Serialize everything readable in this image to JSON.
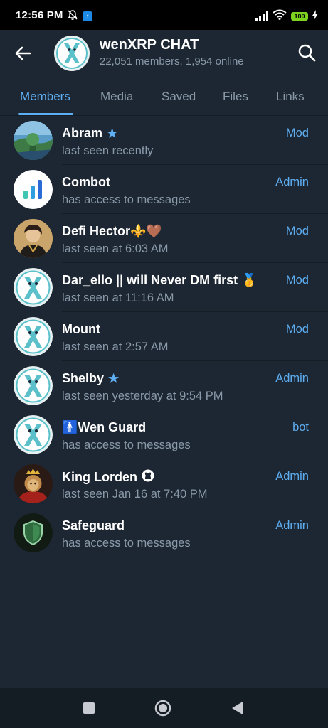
{
  "status_bar": {
    "time": "12:56 PM",
    "battery": "100",
    "icons": [
      "mute-notification-icon",
      "app-update-icon",
      "signal-icon",
      "wifi-icon",
      "battery-icon",
      "charging-icon"
    ]
  },
  "header": {
    "title": "wenXRP CHAT",
    "subtitle": "22,051 members, 1,954 online",
    "back_icon": "back-arrow-icon",
    "search_icon": "search-icon"
  },
  "tabs": [
    {
      "label": "Members",
      "active": true
    },
    {
      "label": "Media",
      "active": false
    },
    {
      "label": "Saved",
      "active": false
    },
    {
      "label": "Files",
      "active": false
    },
    {
      "label": "Links",
      "active": false
    }
  ],
  "members": [
    {
      "name": "Abram",
      "badge": "★",
      "status": "last seen recently",
      "role": "Mod",
      "avatar": "landscape"
    },
    {
      "name": "Combot",
      "badge": "",
      "status": "has access to messages",
      "role": "Admin",
      "avatar": "combot"
    },
    {
      "name": "Defi Hector⚜️🤎",
      "badge": "",
      "status": "last seen at 6:03 AM",
      "role": "Mod",
      "avatar": "person"
    },
    {
      "name": "Dar_ello || will Never DM first 🥇",
      "badge": "",
      "status": "last seen at 11:16 AM",
      "role": "Mod",
      "avatar": "x-logo"
    },
    {
      "name": "Mount",
      "badge": "",
      "status": "last seen at 2:57 AM",
      "role": "Mod",
      "avatar": "x-logo"
    },
    {
      "name": "Shelby",
      "badge": "★",
      "status": "last seen yesterday at 9:54 PM",
      "role": "Admin",
      "avatar": "x-logo"
    },
    {
      "name": "🚹Wen Guard",
      "badge": "",
      "status": "has access to messages",
      "role": "bot",
      "avatar": "x-logo"
    },
    {
      "name": "King Lorden",
      "badge": "",
      "status": "last seen Jan 16 at 7:40 PM",
      "role": "Admin",
      "avatar": "lion-king"
    },
    {
      "name": "Safeguard",
      "badge": "",
      "status": "has access to messages",
      "role": "Admin",
      "avatar": "shield"
    }
  ],
  "colors": {
    "background": "#1d2733",
    "accent": "#5eaef2",
    "secondary_text": "#8a9aa8",
    "x_logo": "#5bc0c9"
  }
}
